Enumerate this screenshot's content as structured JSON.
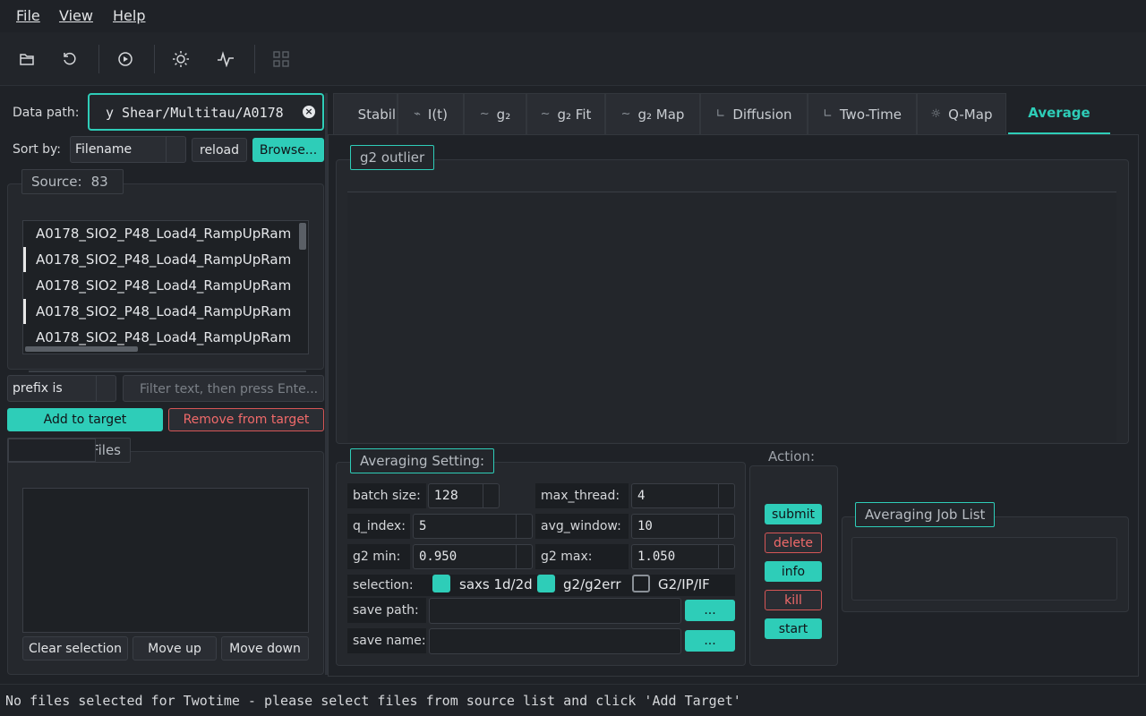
{
  "menu": {
    "file": "File",
    "view": "View",
    "help": "Help"
  },
  "toolbar": {
    "icons": [
      "folder-open-icon",
      "refresh-icon",
      "play-icon",
      "sun-icon",
      "pulse-icon",
      "qr-grid-icon"
    ]
  },
  "left": {
    "data_path_label": "Data path:",
    "data_path_value": "y Shear/Multitau/A0178",
    "sort_label": "Sort by:",
    "sort_value": "Filename",
    "reload": "reload",
    "browse": "Browse...",
    "source_title": "Source:",
    "source_count": "83",
    "source_files": [
      "A0178_SIO2_P48_Load4_RampUpRam",
      "A0178_SIO2_P48_Load4_RampUpRam",
      "A0178_SIO2_P48_Load4_RampUpRam",
      "A0178_SIO2_P48_Load4_RampUpRam",
      "A0178_SIO2_P48_Load4_RampUpRam"
    ],
    "filter_mode": "prefix is",
    "filter_placeholder": "Filter text, then press Ente...",
    "add_target": "Add to target",
    "remove_target": "Remove from target",
    "target_title": "Files",
    "clear_selection": "Clear selection",
    "move_up": "Move up",
    "move_down": "Move down"
  },
  "tabs": [
    {
      "label": "Stability",
      "icon": ""
    },
    {
      "label": "I(t)",
      "icon": "pulse-icon"
    },
    {
      "label": "g₂",
      "icon": "curve-icon"
    },
    {
      "label": "g₂ Fit",
      "icon": "curve-icon"
    },
    {
      "label": "g₂ Map",
      "icon": "curve-icon"
    },
    {
      "label": "Diffusion",
      "icon": "axis-icon"
    },
    {
      "label": "Two-Time",
      "icon": "axis-icon"
    },
    {
      "label": "Q-Map",
      "icon": "sun-icon"
    },
    {
      "label": "Average",
      "icon": ""
    }
  ],
  "average": {
    "outlier_title": "g2 outlier",
    "settings_title": "Averaging Setting:",
    "batch_size_label": "batch size:",
    "batch_size": "128",
    "max_thread_label": "max_thread:",
    "max_thread": "4",
    "q_index_label": "q_index:",
    "q_index": "5",
    "avg_window_label": "avg_window:",
    "avg_window": "10",
    "g2_min_label": "g2 min:",
    "g2_min": "0.950",
    "g2_max_label": "g2 max:",
    "g2_max": "1.050",
    "selection_label": "selection:",
    "chk1": "saxs 1d/2d",
    "chk2": "g2/g2err",
    "chk3": "G2/IP/IF",
    "save_path_label": "save path:",
    "save_name_label": "save name:",
    "dots": "...",
    "action_title": "Action:",
    "submit": "submit",
    "delete": "delete",
    "info": "info",
    "kill": "kill",
    "start": "start",
    "job_list_title": "Averaging Job List"
  },
  "status": "No files selected for Twotime - please select files from source list and click 'Add Target'",
  "colors": {
    "accent": "#2ecdb8",
    "danger": "#f06a6a",
    "bg": "#1f2227"
  }
}
